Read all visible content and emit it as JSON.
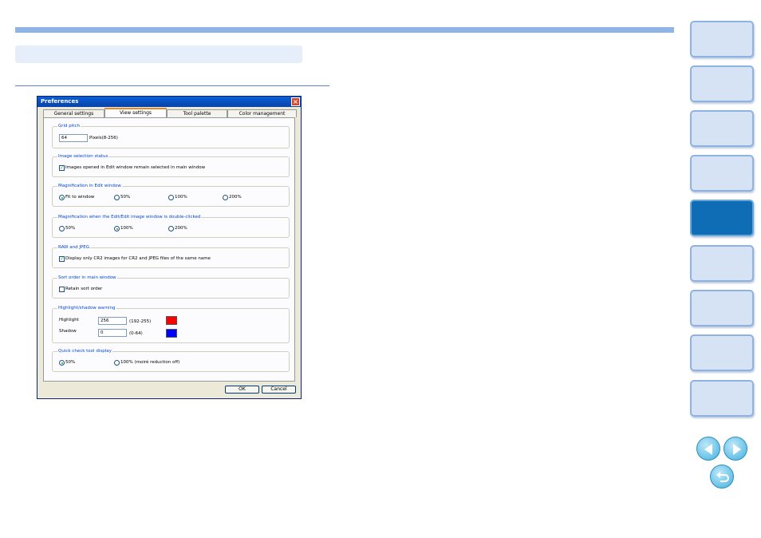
{
  "dialog": {
    "title": "Preferences",
    "tabs": [
      "General settings",
      "View settings",
      "Tool palette",
      "Color management"
    ],
    "active_tab": "View settings",
    "grid_pitch": {
      "title": "Grid pitch",
      "value": "64",
      "range": "Pixels(8-256)"
    },
    "image_selection": {
      "title": "Image selection status",
      "label": "Images opened in Edit window remain selected in main window",
      "checked": true
    },
    "magnification": {
      "title": "Magnification in Edit window",
      "options": [
        "Fit to window",
        "50%",
        "100%",
        "200%"
      ],
      "selected": "Fit to window"
    },
    "magnification_dbl": {
      "title": "Magnification when the Edit/Edit image window is double-clicked",
      "options": [
        "50%",
        "100%",
        "200%"
      ],
      "selected": "100%"
    },
    "raw_jpeg": {
      "title": "RAW and JPEG",
      "label": "Display only CR2 images for CR2 and JPEG files of the same name",
      "checked": true
    },
    "sort_order": {
      "title": "Sort order in main window",
      "label": "Retain sort order",
      "checked": false
    },
    "warning": {
      "title": "Highlight/shadow warning",
      "highlight_label": "Highlight",
      "highlight_value": "256",
      "highlight_range": "(192-255)",
      "highlight_color": "#ff0000",
      "shadow_label": "Shadow",
      "shadow_value": "0",
      "shadow_range": "(0-64)",
      "shadow_color": "#0000ff"
    },
    "quick_check": {
      "title": "Quick check tool display",
      "options": [
        "50%",
        "100% (moiré reduction off)"
      ],
      "selected": "50%"
    },
    "ok_label": "OK",
    "cancel_label": "Cancel"
  },
  "nav": {
    "active_index": 4,
    "accent_color": "#0e6db5",
    "icons": [
      "previous-page-icon",
      "next-page-icon",
      "return-icon"
    ]
  }
}
